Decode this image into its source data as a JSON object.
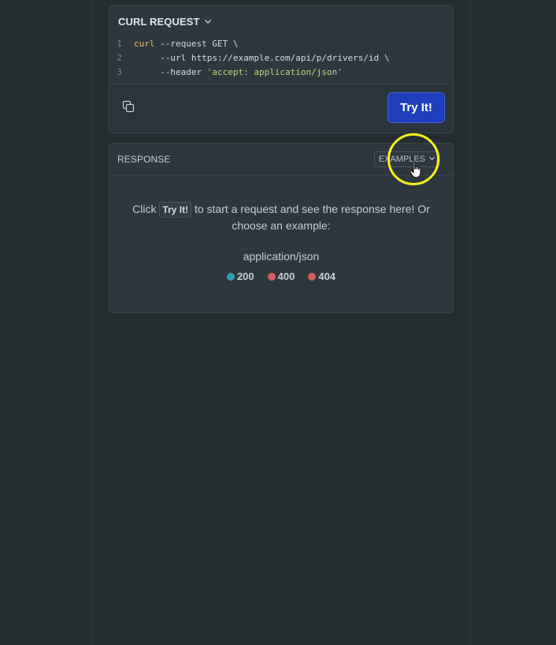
{
  "curl": {
    "title": "CURL REQUEST",
    "lines": [
      {
        "num": "1",
        "kw": "curl",
        "rest": " --request GET \\",
        "str": "",
        "tail": ""
      },
      {
        "num": "2",
        "kw": "",
        "rest": "     --url https://example.com/api/p/drivers/id \\",
        "str": "",
        "tail": ""
      },
      {
        "num": "3",
        "kw": "",
        "rest": "     --header ",
        "str": "'accept: application/json'",
        "tail": ""
      }
    ],
    "try_label": "Try It!"
  },
  "response": {
    "title": "RESPONSE",
    "examples_label": "EXAMPLES",
    "msg_before": "Click ",
    "msg_kbd": "Try It!",
    "msg_after": " to start a request and see the response here! Or choose an example:",
    "content_type": "application/json",
    "statuses": [
      {
        "code": "200",
        "color": "#2aa0b5"
      },
      {
        "code": "400",
        "color": "#d65d5d"
      },
      {
        "code": "404",
        "color": "#d65d5d"
      }
    ]
  },
  "colors": {
    "background": "#252d31",
    "card": "#2e373e",
    "accent": "#1e3fbd",
    "highlight": "#f7f11b"
  },
  "icons": {
    "copy": "copy-icon",
    "chevron": "chevron-down-icon",
    "cursor": "hand-pointer-icon"
  }
}
